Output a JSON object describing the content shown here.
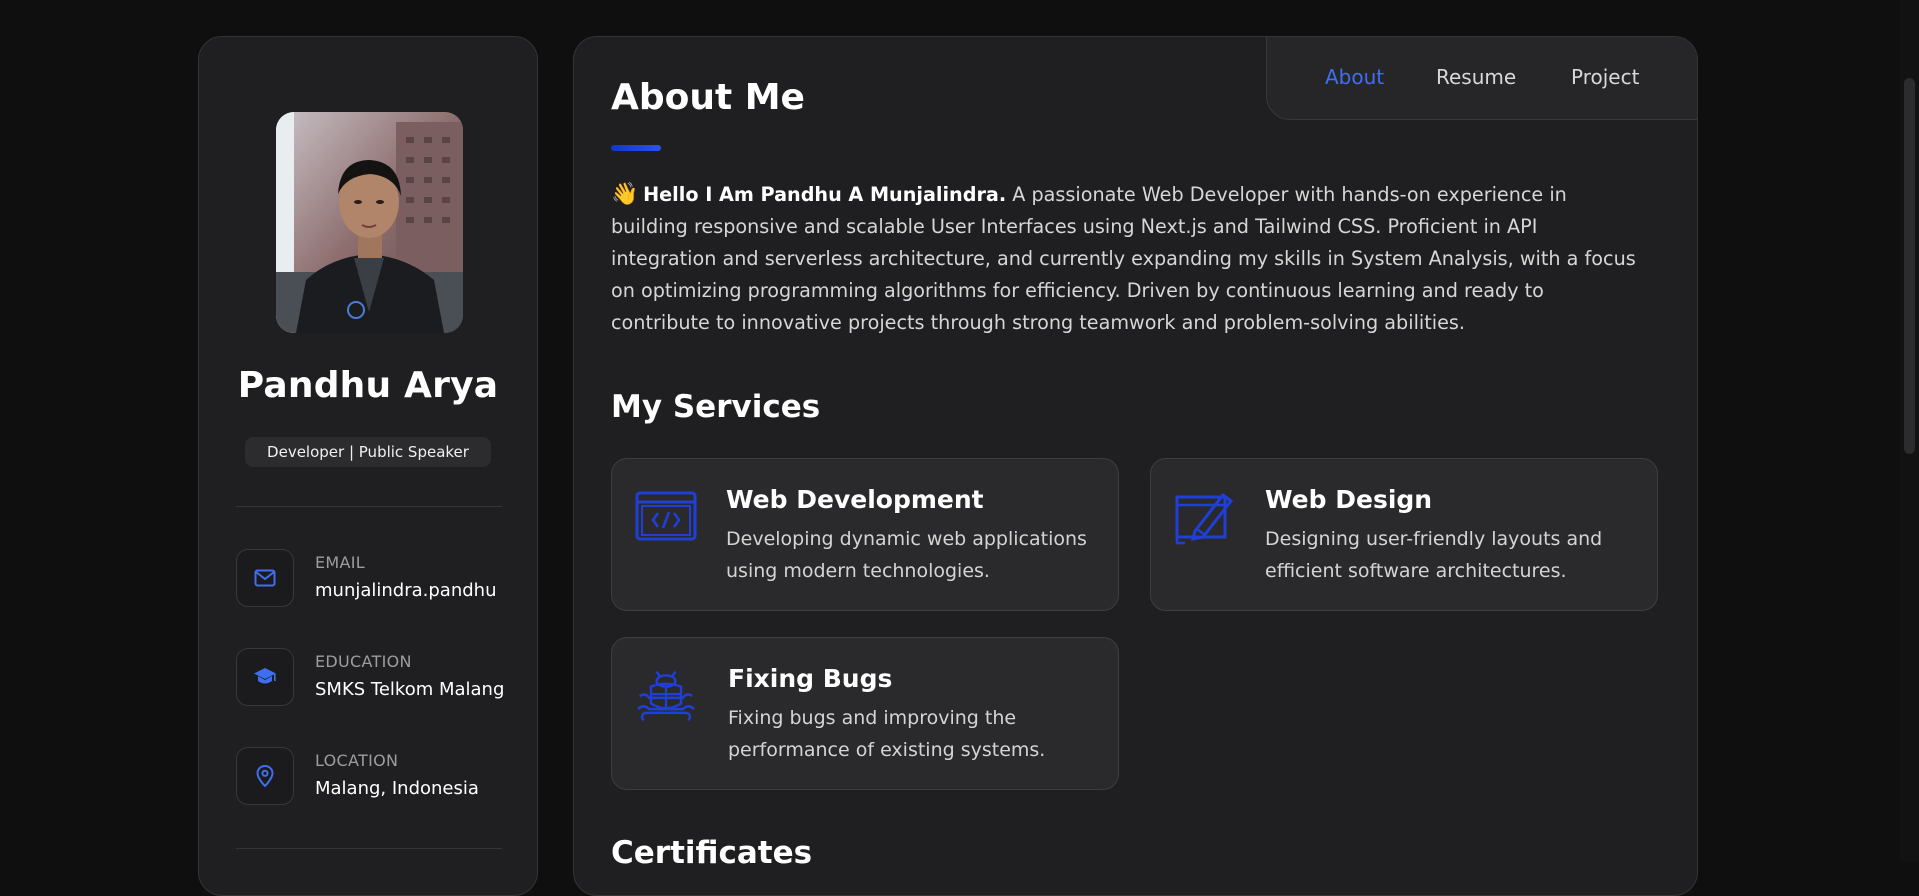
{
  "profile": {
    "name": "Pandhu Arya",
    "role": "Developer | Public Speaker",
    "avatar_alt": "Profile photo"
  },
  "contacts": [
    {
      "label": "EMAIL",
      "value": "munjalindra.pandhu",
      "icon": "mail-icon"
    },
    {
      "label": "EDUCATION",
      "value": "SMKS Telkom Malang",
      "icon": "graduation-cap-icon"
    },
    {
      "label": "LOCATION",
      "value": "Malang, Indonesia",
      "icon": "map-pin-icon"
    }
  ],
  "nav": {
    "items": [
      {
        "label": "About",
        "active": true
      },
      {
        "label": "Resume",
        "active": false
      },
      {
        "label": "Project",
        "active": false
      }
    ]
  },
  "about": {
    "title": "About Me",
    "greeting": "Hello I Am Pandhu A Munjalindra.",
    "wave": "👋",
    "body": "A passionate Web Developer with hands-on experience in building responsive and scalable User Interfaces using Next.js and Tailwind CSS. Proficient in API integration and serverless architecture, and currently expanding my skills in System Analysis, with a focus on optimizing programming algorithms for efficiency. Driven by continuous learning and ready to contribute to innovative projects through strong teamwork and problem-solving abilities."
  },
  "services": {
    "title": "My Services",
    "items": [
      {
        "title": "Web Development",
        "desc": "Developing dynamic web applications using modern technologies.",
        "icon": "code-window-icon"
      },
      {
        "title": "Web Design",
        "desc": "Designing user-friendly layouts and efficient software architectures.",
        "icon": "design-pen-icon"
      },
      {
        "title": "Fixing Bugs",
        "desc": "Fixing bugs and improving the performance of existing systems.",
        "icon": "bug-wrench-icon"
      }
    ]
  },
  "certificates": {
    "title": "Certificates"
  },
  "colors": {
    "accent": "#3f6ff0",
    "icon_blue": "#1f3fd6",
    "background": "#0f0f10",
    "panel": "#1f1f21",
    "card": "#2a2a2c"
  }
}
